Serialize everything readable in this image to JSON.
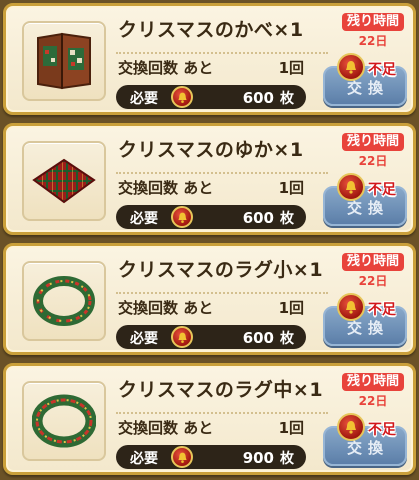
{
  "colors": {
    "card_border": "#caa03a",
    "remaining_badge": "#e8433b",
    "exchange_button": "#5b81b0",
    "shortage_text": "#d2161a",
    "cost_bar": "#2d2418"
  },
  "items": [
    {
      "icon": "christmas-wall-icon",
      "name": "クリスマスのかべ×1",
      "exchange_label": "交換回数 あと",
      "exchange_count": "1回",
      "cost_label": "必要",
      "cost_icon": "bell-coin-icon",
      "cost_value": "600",
      "cost_unit": "枚",
      "remaining_label": "残り時間",
      "remaining_days": "22日",
      "button_label": "交換",
      "shortage_label": "不足"
    },
    {
      "icon": "christmas-floor-icon",
      "name": "クリスマスのゆか×1",
      "exchange_label": "交換回数 あと",
      "exchange_count": "1回",
      "cost_label": "必要",
      "cost_icon": "bell-coin-icon",
      "cost_value": "600",
      "cost_unit": "枚",
      "remaining_label": "残り時間",
      "remaining_days": "22日",
      "button_label": "交換",
      "shortage_label": "不足"
    },
    {
      "icon": "christmas-rug-small-icon",
      "name": "クリスマスのラグ小×1",
      "exchange_label": "交換回数 あと",
      "exchange_count": "1回",
      "cost_label": "必要",
      "cost_icon": "bell-coin-icon",
      "cost_value": "600",
      "cost_unit": "枚",
      "remaining_label": "残り時間",
      "remaining_days": "22日",
      "button_label": "交換",
      "shortage_label": "不足"
    },
    {
      "icon": "christmas-rug-medium-icon",
      "name": "クリスマスのラグ中×1",
      "exchange_label": "交換回数 あと",
      "exchange_count": "1回",
      "cost_label": "必要",
      "cost_icon": "bell-coin-icon",
      "cost_value": "900",
      "cost_unit": "枚",
      "remaining_label": "残り時間",
      "remaining_days": "22日",
      "button_label": "交換",
      "shortage_label": "不足"
    }
  ]
}
